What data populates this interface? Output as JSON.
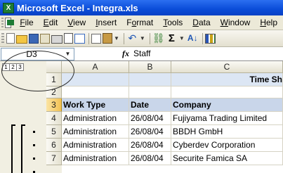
{
  "window": {
    "title": "Microsoft Excel - Integra.xls",
    "app_icon": "excel-icon"
  },
  "menu": {
    "items": [
      {
        "key": "F",
        "rest": "ile"
      },
      {
        "key": "E",
        "rest": "dit"
      },
      {
        "key": "V",
        "rest": "iew"
      },
      {
        "key": "I",
        "rest": "nsert"
      },
      {
        "key": "o",
        "prefix": "F",
        "rest": "rmat"
      },
      {
        "key": "T",
        "rest": "ools"
      },
      {
        "key": "D",
        "rest": "ata"
      },
      {
        "key": "W",
        "rest": "indow"
      },
      {
        "key": "H",
        "rest": "elp"
      }
    ]
  },
  "toolbar": {
    "icons": [
      "new-icon",
      "open-icon",
      "save-icon",
      "permission-icon",
      "print-icon",
      "print-preview-icon",
      "spelling-icon",
      "copy-icon",
      "paste-icon",
      "undo-icon",
      "hyperlink-icon",
      "autosum-icon",
      "sort-ascending-icon",
      "chart-wizard-icon"
    ],
    "sum_glyph": "Σ",
    "sort_glyph": "A↓"
  },
  "formula_bar": {
    "name_box": "D3",
    "fx": "fx",
    "formula": "Staff"
  },
  "outline": {
    "levels": [
      "1",
      "2",
      "3"
    ]
  },
  "columns": [
    "A",
    "B",
    "C"
  ],
  "active_column": "D",
  "rows": [
    {
      "num": "1",
      "a": "",
      "b": "",
      "c": "Time Sh"
    },
    {
      "num": "2",
      "a": "",
      "b": "",
      "c": ""
    },
    {
      "num": "3",
      "a": "Work Type",
      "b": "Date",
      "c": "Company"
    },
    {
      "num": "4",
      "a": "Administration",
      "b": "26/08/04",
      "c": "Fujiyama Trading Limited"
    },
    {
      "num": "5",
      "a": "Administration",
      "b": "26/08/04",
      "c": "BBDH GmbH"
    },
    {
      "num": "6",
      "a": "Administration",
      "b": "26/08/04",
      "c": "Cyberdev Corporation"
    },
    {
      "num": "7",
      "a": "Administration",
      "b": "26/08/04",
      "c": "Securite Famica SA"
    }
  ]
}
